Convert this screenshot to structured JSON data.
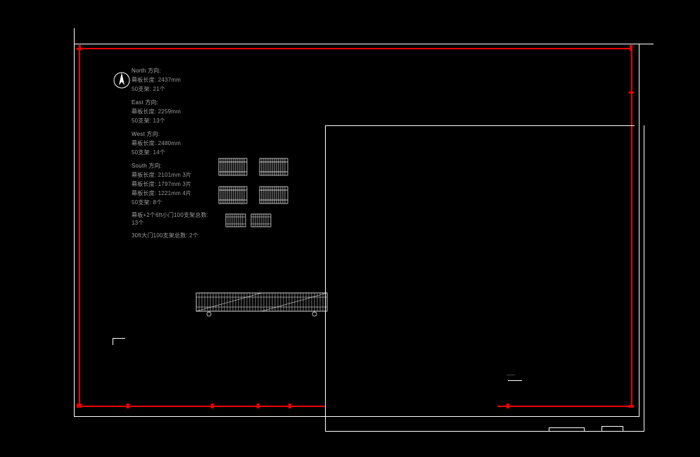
{
  "directions": {
    "north": {
      "header": "North 方向:",
      "panel_len": "幕板长度: 2437mm",
      "bracket": "50支架: 21个"
    },
    "east": {
      "header": "East 方向:",
      "panel_len": "幕板长度: 2259mm",
      "bracket": "50支架: 13个"
    },
    "west": {
      "header": "West 方向:",
      "panel_len": "幕板长度: 2480mm",
      "bracket": "50支架: 14个"
    },
    "south": {
      "header": "South 方向:",
      "row1": "幕板长度: 2101mm  3片",
      "row2": "幕板长度: 1797mm  3片",
      "row3": "幕板长度: 1221mm  4片",
      "bracket": "50支架: 8个"
    }
  },
  "extras": {
    "small_gate": "幕板+2个6ft小门100支架总数: 13个",
    "big_gate": "30ft大门100支架总数: 2个"
  }
}
